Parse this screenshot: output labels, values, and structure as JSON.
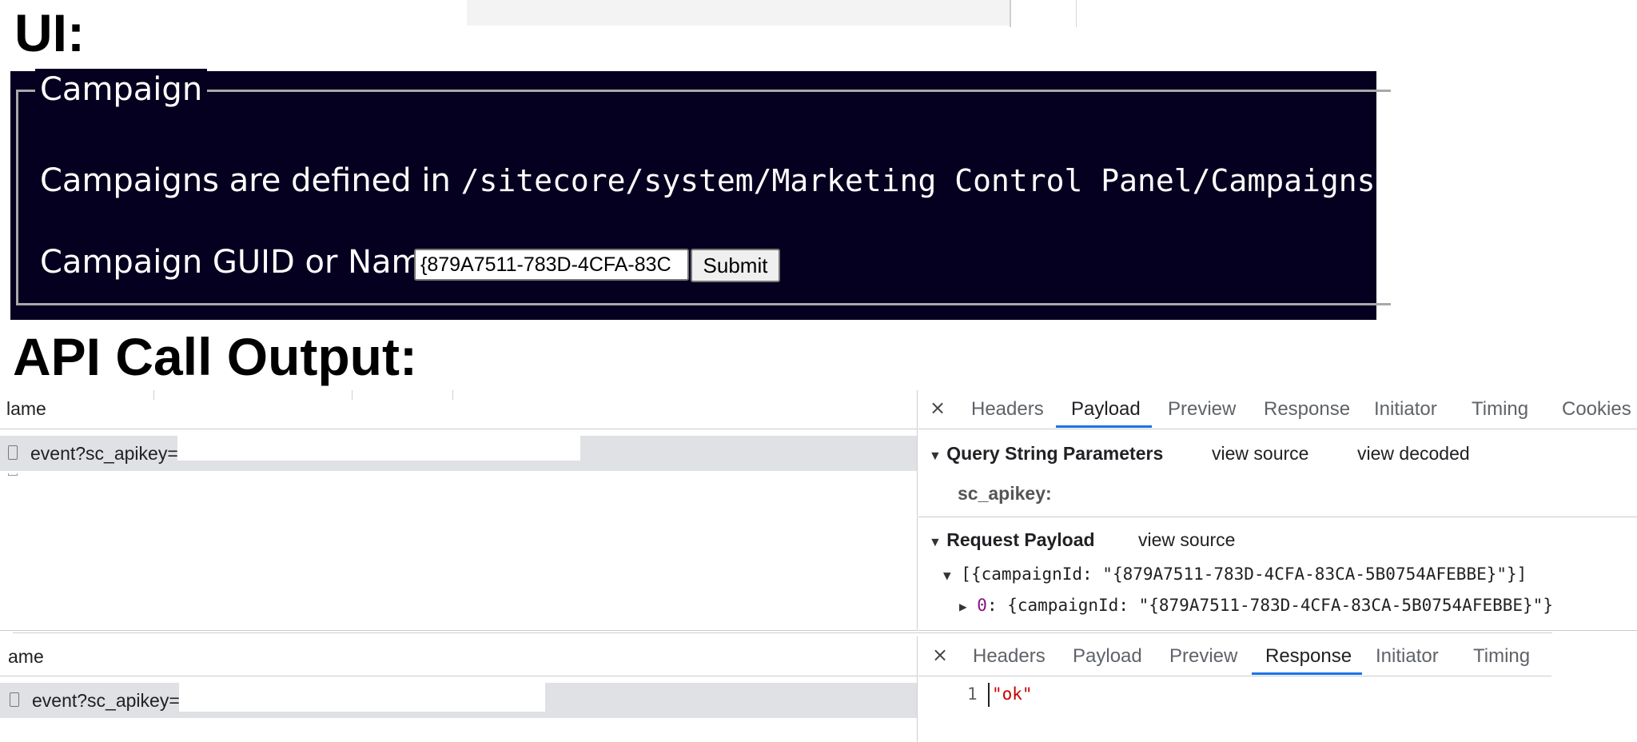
{
  "ui_heading": "UI:",
  "campaign": {
    "legend": "Campaign",
    "description_text": "Campaigns are defined in ",
    "description_path": "/sitecore/system/Marketing Control Panel/Campaigns",
    "guid_label": "Campaign GUID or Name",
    "guid_value": "{879A7511-783D-4CFA-83C",
    "submit_label": "Submit"
  },
  "api_heading": "API Call Output:",
  "devtools_top": {
    "name_header": "lame",
    "request_name": "event?sc_apikey=",
    "tabs": [
      "Headers",
      "Payload",
      "Preview",
      "Response",
      "Initiator",
      "Timing",
      "Cookies"
    ],
    "active_tab": "Payload",
    "close_glyph": "×",
    "query_section": {
      "title": "Query String Parameters",
      "view_source": "view source",
      "view_decoded": "view decoded",
      "param_key": "sc_apikey:"
    },
    "payload_section": {
      "title": "Request Payload",
      "view_source": "view source",
      "array_line": "[{campaignId: \"{879A7511-783D-4CFA-83CA-5B0754AFEBBE}\"}]",
      "item_index": "0",
      "item_line": ": {campaignId: \"{879A7511-783D-4CFA-83CA-5B0754AFEBBE}\"}"
    }
  },
  "devtools_bottom": {
    "name_header": "ame",
    "request_name": "event?sc_apikey=",
    "tabs": [
      "Headers",
      "Payload",
      "Preview",
      "Response",
      "Initiator",
      "Timing"
    ],
    "active_tab": "Response",
    "close_glyph": "×",
    "response_line_number": "1",
    "response_body": "\"ok\""
  },
  "colors": {
    "panel_bg": "#05001f",
    "tab_accent": "#1a73e8",
    "string_red": "#c80000",
    "index_purple": "#881280"
  }
}
